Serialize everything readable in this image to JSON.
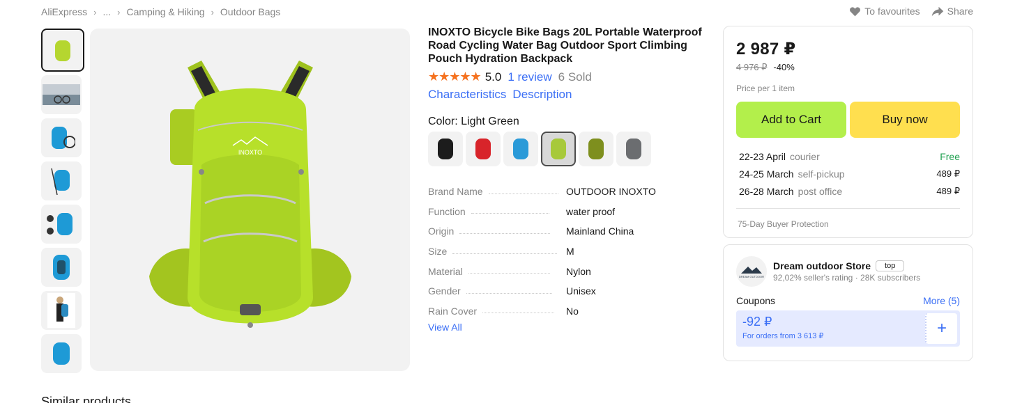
{
  "breadcrumb": {
    "items": [
      "AliExpress",
      "...",
      "Camping & Hiking",
      "Outdoor Bags"
    ]
  },
  "top_actions": {
    "favourites": "To favourites",
    "share": "Share"
  },
  "product": {
    "title": "INOXTO Bicycle Bike Bags 20L Portable Waterproof Road Cycling Water Bag Outdoor Sport Climbing Pouch Hydration Backpack",
    "rating": "5.0",
    "stars": "★★★★★",
    "reviews": "1 review",
    "sold": "6 Sold",
    "tabs": [
      "Characteristics",
      "Description"
    ],
    "color_label": "Color: Light Green",
    "colors": [
      "#1c1c1c",
      "#d8242a",
      "#2a9ad8",
      "#a7c93a",
      "#7e8f1e",
      "#6b6d70"
    ],
    "specs": [
      {
        "key": "Brand Name",
        "value": "OUTDOOR INOXTO"
      },
      {
        "key": "Function",
        "value": "water proof"
      },
      {
        "key": "Origin",
        "value": "Mainland China"
      },
      {
        "key": "Size",
        "value": "M"
      },
      {
        "key": "Material",
        "value": "Nylon"
      },
      {
        "key": "Gender",
        "value": "Unisex"
      },
      {
        "key": "Rain Cover",
        "value": "No"
      }
    ],
    "view_all": "View All"
  },
  "gallery": {
    "thumb_colors": [
      "#b5d630",
      "#7a8c99",
      "#1e9ad6",
      "#1e9ad6",
      "#1e9ad6",
      "#1e9ad6",
      "#2a8ac0",
      "#1e9ad6"
    ],
    "main_color": "#b7e02a"
  },
  "pricing": {
    "price": "2 987 ₽",
    "old_price": "4 976 ₽",
    "discount": "-40%",
    "note": "Price per 1 item",
    "add_to_cart": "Add to Cart",
    "buy_now": "Buy now",
    "shipping": [
      {
        "date": "22-23 April",
        "method": "courier",
        "price": "Free"
      },
      {
        "date": "24-25 March",
        "method": "self-pickup",
        "price": "489 ₽"
      },
      {
        "date": "26-28 March",
        "method": "post office",
        "price": "489 ₽"
      }
    ],
    "protection": "75-Day Buyer Protection"
  },
  "store": {
    "name": "Dream outdoor Store",
    "badge": "top",
    "rating": "92,02% seller's rating",
    "subscribers": "28K subscribers",
    "coupons_title": "Coupons",
    "coupons_more": "More (5)",
    "coupon_amount": "-92 ₽",
    "coupon_condition": "For orders from 3 613 ₽",
    "logo_text": "DREAM OUTDOOR"
  },
  "similar_title": "Similar products"
}
